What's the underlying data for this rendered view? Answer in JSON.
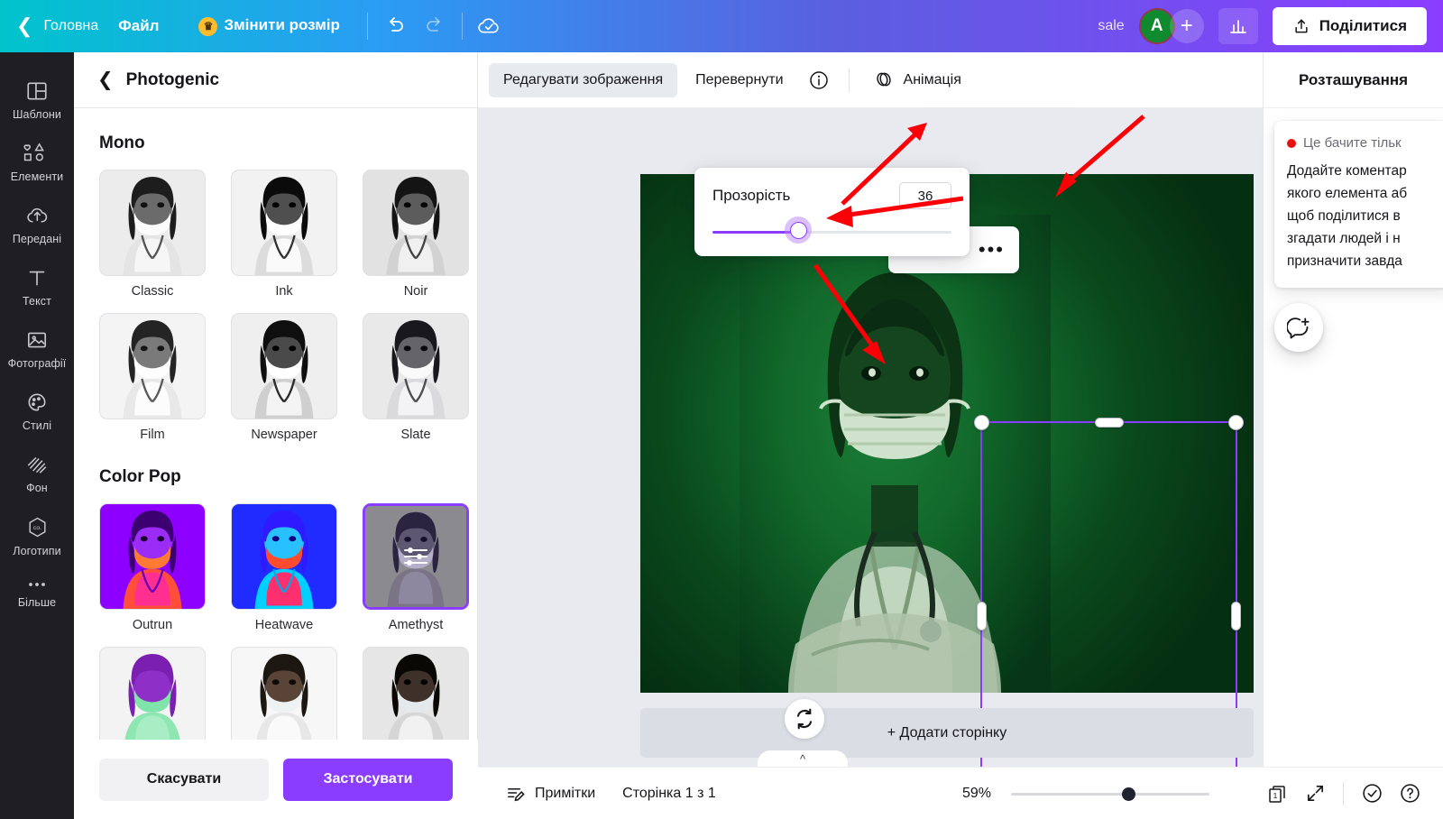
{
  "topbar": {
    "back_label": "Головна",
    "file_label": "Файл",
    "resize_label": "Змінити розмір",
    "crown_icon": "crown-icon",
    "undo_icon": "undo-icon",
    "redo_icon": "redo-icon",
    "cloud_icon": "cloud-check-icon",
    "user_name": "sale",
    "avatar_initial": "A",
    "add_label": "+",
    "stats_icon": "bar-chart-icon",
    "share_label": "Поділитися",
    "share_icon": "upload-icon"
  },
  "rail": {
    "items": [
      {
        "label": "Шаблони",
        "icon": "templates-icon"
      },
      {
        "label": "Елементи",
        "icon": "elements-icon"
      },
      {
        "label": "Передані",
        "icon": "uploads-cloud-icon"
      },
      {
        "label": "Текст",
        "icon": "text-icon"
      },
      {
        "label": "Фотографії",
        "icon": "photos-icon"
      },
      {
        "label": "Стилі",
        "icon": "styles-palette-icon"
      },
      {
        "label": "Фон",
        "icon": "background-icon"
      },
      {
        "label": "Логотипи",
        "icon": "logos-icon"
      },
      {
        "label": "Більше",
        "icon": "more-dots-icon"
      }
    ]
  },
  "panel": {
    "title": "Photogenic",
    "back_icon": "chevron-left-icon",
    "sections": [
      {
        "title": "Mono",
        "filters": [
          {
            "label": "Classic",
            "selected": false
          },
          {
            "label": "Ink",
            "selected": false
          },
          {
            "label": "Noir",
            "selected": false
          },
          {
            "label": "Film",
            "selected": false
          },
          {
            "label": "Newspaper",
            "selected": false
          },
          {
            "label": "Slate",
            "selected": false
          }
        ]
      },
      {
        "title": "Color Pop",
        "filters": [
          {
            "label": "Outrun",
            "selected": false
          },
          {
            "label": "Heatwave",
            "selected": false
          },
          {
            "label": "Amethyst",
            "selected": true
          }
        ]
      }
    ],
    "cancel_label": "Скасувати",
    "apply_label": "Застосувати"
  },
  "editor_toolbar": {
    "edit_image_label": "Редагувати зображення",
    "flip_label": "Перевернути",
    "info_icon": "info-icon",
    "animate_label": "Анімація",
    "animate_icon": "animate-icon",
    "more_label": "•••"
  },
  "substrip": {
    "transparency_icon": "transparency-checker-icon",
    "link_icon": "link-icon",
    "lock_icon": "lock-open-icon"
  },
  "canvas_top_icons": [
    {
      "icon": "lock-open-icon"
    },
    {
      "icon": "duplicate-icon"
    },
    {
      "icon": "delete-icon"
    }
  ],
  "popover": {
    "title": "Прозорість",
    "value": "36",
    "slider_percent": 36,
    "accent_color": "#8b3dff"
  },
  "float_toolbar": {
    "more_label": "•••"
  },
  "add_page": {
    "label": "+ Додати сторінку",
    "spinner_icon": "loading-spinner-icon",
    "collapse_icon": "chevron-up-icon"
  },
  "rightbar": {
    "title": "Розташування",
    "note_badge": "Це бачите тільк",
    "note_body": "Додайте коментар\nякого елемента аб\nщоб поділитися в\nзгадати людей і н\nпризначити завда",
    "comment_fab_icon": "add-comment-icon"
  },
  "bottombar": {
    "notes_label": "Примітки",
    "notes_icon": "notes-icon",
    "page_label": "Сторінка 1 з 1",
    "zoom_label": "59%",
    "zoom_percent": 59,
    "pages_icon": "pages-icon",
    "pages_count": "1",
    "fullscreen_icon": "fullscreen-icon",
    "check_icon": "check-circle-icon",
    "help_icon": "help-circle-icon"
  }
}
